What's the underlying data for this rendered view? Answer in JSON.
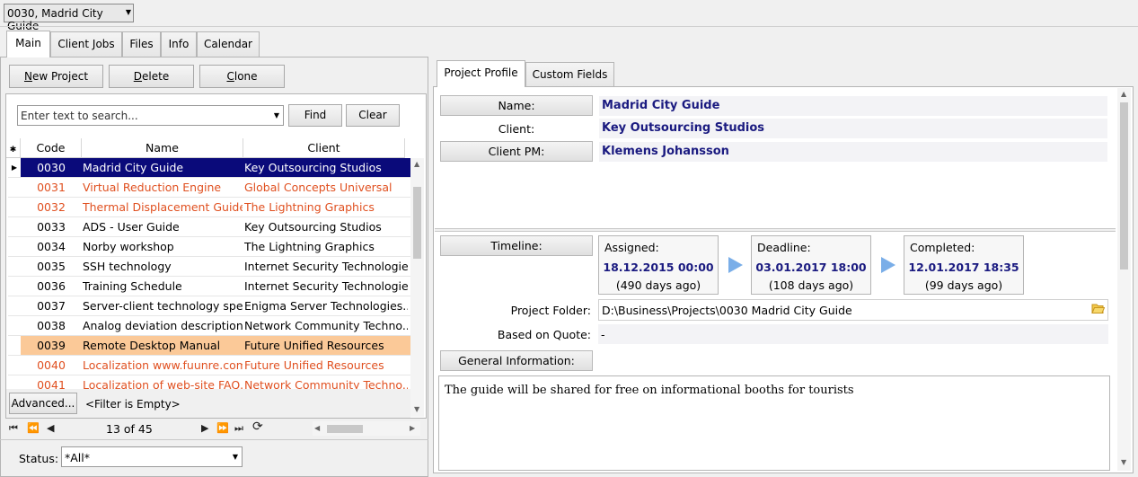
{
  "top_selector": {
    "value": "0030, Madrid City Guide"
  },
  "main_tabs": [
    "Main",
    "Client Jobs",
    "Files",
    "Info",
    "Calendar"
  ],
  "toolbar": {
    "new_project_u": "N",
    "new_project": "ew Project",
    "delete_u": "D",
    "delete": "elete",
    "clone_u": "C",
    "clone": "lone"
  },
  "search": {
    "placeholder": "Enter text to search...",
    "find": "Find",
    "clear": "Clear"
  },
  "grid": {
    "columns": [
      "Code",
      "Name",
      "Client"
    ],
    "rows": [
      {
        "code": "0030",
        "name": "Madrid City Guide",
        "client": "Key Outsourcing Studios"
      },
      {
        "code": "0031",
        "name": "Virtual Reduction Engine",
        "client": "Global Concepts Universal"
      },
      {
        "code": "0032",
        "name": "Thermal Displacement Guide",
        "client": "The Lightning Graphics"
      },
      {
        "code": "0033",
        "name": "ADS - User Guide",
        "client": "Key Outsourcing Studios"
      },
      {
        "code": "0034",
        "name": "Norby workshop",
        "client": "The Lightning Graphics"
      },
      {
        "code": "0035",
        "name": "SSH technology",
        "client": "Internet Security Technologies"
      },
      {
        "code": "0036",
        "name": "Training Schedule",
        "client": "Internet Security Technologies"
      },
      {
        "code": "0037",
        "name": "Server-client technology spe...",
        "client": "Enigma Server Technologies..."
      },
      {
        "code": "0038",
        "name": "Analog deviation description",
        "client": "Network Community Techno..."
      },
      {
        "code": "0039",
        "name": "Remote Desktop Manual",
        "client": "Future Unified Resources"
      },
      {
        "code": "0040",
        "name": "Localization www.fuunre.com",
        "client": "Future Unified Resources"
      },
      {
        "code": "0041",
        "name": "Localization of web-site FAQ...",
        "client": "Network Community Techno..."
      }
    ]
  },
  "filter": {
    "advanced": "Advanced...",
    "status": "<Filter is Empty>"
  },
  "navigator": {
    "position": "13 of 45"
  },
  "status_filter": {
    "label": "Status:",
    "value": "*All*"
  },
  "right_tabs": [
    "Project Profile",
    "Custom Fields"
  ],
  "profile": {
    "name_label": "Name:",
    "name": "Madrid City Guide",
    "client_label": "Client:",
    "client": "Key Outsourcing Studios",
    "pm_label": "Client PM:",
    "pm": "Klemens Johansson",
    "timeline_label": "Timeline:",
    "assigned_label": "Assigned:",
    "assigned_date": "18.12.2015 00:00",
    "assigned_ago": "(490 days ago)",
    "deadline_label": "Deadline:",
    "deadline_date": "03.01.2017 18:00",
    "deadline_ago": "(108 days ago)",
    "completed_label": "Completed:",
    "completed_date": "12.01.2017 18:35",
    "completed_ago": "(99 days ago)",
    "folder_label": "Project Folder:",
    "folder": "D:\\Business\\Projects\\0030 Madrid City Guide",
    "quote_label": "Based on Quote:",
    "quote": "-",
    "general_info_label": "General Information:",
    "general_info": "The guide will be shared for free on informational booths for tourists"
  },
  "colors": {
    "selected_bg": "#0a0a7a",
    "red_text": "#e05020",
    "highlight_bg": "#fbc998"
  }
}
